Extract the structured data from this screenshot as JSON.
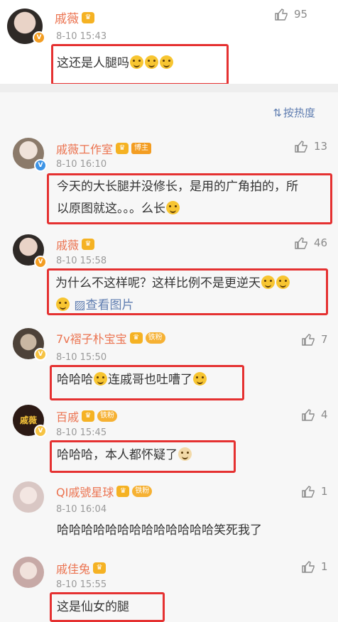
{
  "post": {
    "author": "戚薇",
    "time": "8-10 15:43",
    "likes": "95",
    "text": "这还是人腿吗"
  },
  "sort_label": "按热度",
  "comments": [
    {
      "name": "戚薇工作室",
      "tag": "博主",
      "time": "8-10 16:10",
      "likes": "13",
      "text_line1": "今天的大长腿并没修长，是用的广角拍的，所",
      "text_line2": "以原图就这。。。么长"
    },
    {
      "name": "戚薇",
      "time": "8-10 15:58",
      "likes": "46",
      "text_line1": "为什么不这样呢？这样比例不是更逆天",
      "pic_link": "查看图片"
    },
    {
      "name": "7v褶子朴宝宝",
      "tag": "铁粉",
      "time": "8-10 15:50",
      "likes": "7",
      "text_a": "哈哈哈",
      "text_b": "连戚哥也吐嘈了"
    },
    {
      "name": "百戚",
      "tag": "铁粉",
      "time": "8-10 15:45",
      "likes": "4",
      "text": "哈哈哈，本人都怀疑了",
      "avatar_text": "戚薇"
    },
    {
      "name": "QI戚號星球",
      "tag": "铁粉",
      "time": "8-10 16:04",
      "likes": "1",
      "text": "哈哈哈哈哈哈哈哈哈哈哈哈哈笑死我了"
    },
    {
      "name": "戚佳兔",
      "time": "8-10 15:55",
      "likes": "1",
      "text": "这是仙女的腿"
    }
  ],
  "colors": {
    "name": "#eb7350",
    "link": "#5f7db0",
    "highlight_box": "#e53131",
    "comments_bg": "#f7f7f7"
  },
  "icons": [
    "thumbs-up-icon",
    "crown-icon",
    "sort-icon",
    "image-icon",
    "verified-badge-icon"
  ]
}
